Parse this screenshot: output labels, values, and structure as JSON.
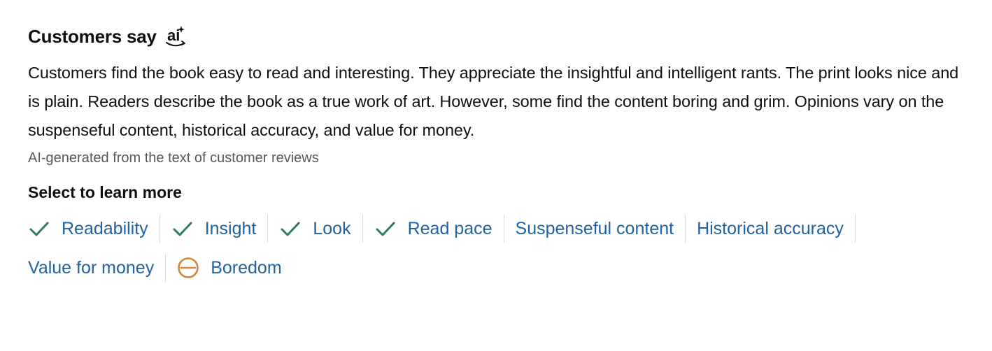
{
  "header": {
    "title": "Customers say",
    "ai_badge_text": "ai"
  },
  "summary": {
    "text": "Customers find the book easy to read and interesting. They appreciate the insightful and intelligent rants. The print looks nice and is plain. Readers describe the book as a true work of art. However, some find the content boring and grim. Opinions vary on the suspenseful content, historical accuracy, and value for money.",
    "note": "AI-generated from the text of customer reviews"
  },
  "aspects": {
    "heading": "Select to learn more",
    "items": [
      {
        "label": "Readability",
        "icon": "check-icon",
        "sentiment": "positive"
      },
      {
        "label": "Insight",
        "icon": "check-icon",
        "sentiment": "positive"
      },
      {
        "label": "Look",
        "icon": "check-icon",
        "sentiment": "positive"
      },
      {
        "label": "Read pace",
        "icon": "check-icon",
        "sentiment": "positive"
      },
      {
        "label": "Suspenseful content",
        "icon": "",
        "sentiment": "mixed"
      },
      {
        "label": "Historical accuracy",
        "icon": "",
        "sentiment": "mixed"
      },
      {
        "label": "Value for money",
        "icon": "",
        "sentiment": "mixed"
      },
      {
        "label": "Boredom",
        "icon": "minus-circle-icon",
        "sentiment": "negative"
      }
    ]
  },
  "colors": {
    "text": "#0f1111",
    "link": "#2162a1",
    "muted": "#565959",
    "positive": "#2f7a6a",
    "negative": "#d6853a",
    "divider": "#d5d9d9"
  }
}
